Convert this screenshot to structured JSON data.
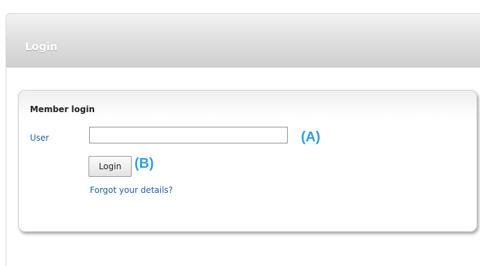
{
  "header": {
    "title": "Login"
  },
  "member_login": {
    "title": "Member login",
    "user_label": "User",
    "user_value": "",
    "login_button": "Login",
    "forgot_link": "Forgot your details?"
  },
  "annotations": {
    "a": "(A)",
    "b": "(B)"
  },
  "colors": {
    "annotation": "#2e9fe0",
    "link": "#1f5fa8"
  }
}
